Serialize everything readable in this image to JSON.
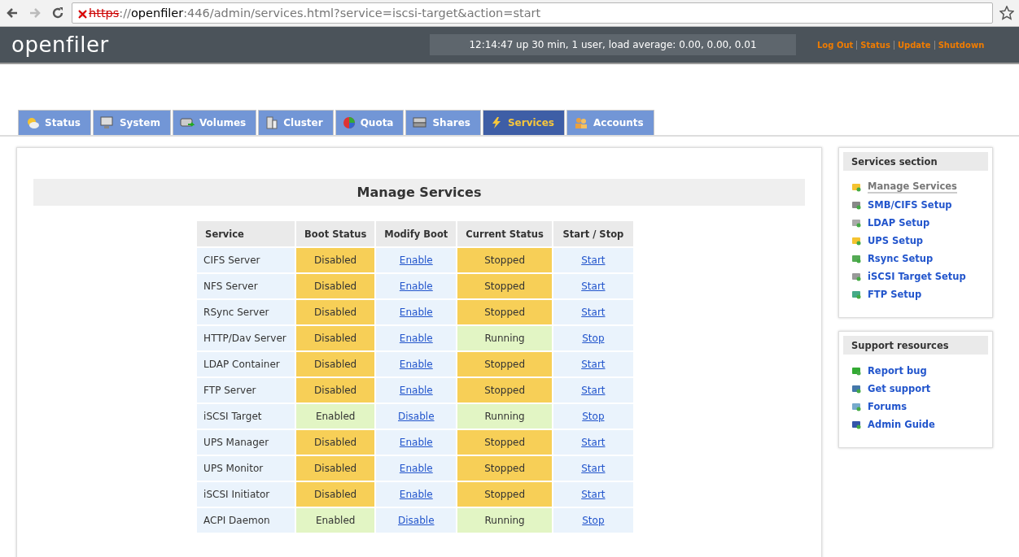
{
  "browser": {
    "secure": false,
    "url": {
      "scheme": "https",
      "separator": "://",
      "host": "openfiler",
      "path": ":446/admin/services.html?service=iscsi-target&action=start"
    }
  },
  "header": {
    "logo": "openfiler",
    "uptime": "12:14:47 up 30 min, 1 user, load average: 0.00, 0.00, 0.01",
    "links": [
      "Log Out",
      "Status",
      "Update",
      "Shutdown"
    ]
  },
  "tabs": [
    {
      "label": "Status",
      "selected": false
    },
    {
      "label": "System",
      "selected": false
    },
    {
      "label": "Volumes",
      "selected": false
    },
    {
      "label": "Cluster",
      "selected": false
    },
    {
      "label": "Quota",
      "selected": false
    },
    {
      "label": "Shares",
      "selected": false
    },
    {
      "label": "Services",
      "selected": true
    },
    {
      "label": "Accounts",
      "selected": false
    }
  ],
  "main": {
    "title": "Manage Services",
    "columns": [
      "Service",
      "Boot Status",
      "Modify Boot",
      "Current Status",
      "Start / Stop"
    ],
    "rows": [
      {
        "service": "CIFS Server",
        "boot_status": "Disabled",
        "boot_enabled": false,
        "modify_boot": "Enable",
        "current_status": "Stopped",
        "running": false,
        "action": "Start"
      },
      {
        "service": "NFS Server",
        "boot_status": "Disabled",
        "boot_enabled": false,
        "modify_boot": "Enable",
        "current_status": "Stopped",
        "running": false,
        "action": "Start"
      },
      {
        "service": "RSync Server",
        "boot_status": "Disabled",
        "boot_enabled": false,
        "modify_boot": "Enable",
        "current_status": "Stopped",
        "running": false,
        "action": "Start"
      },
      {
        "service": "HTTP/Dav Server",
        "boot_status": "Disabled",
        "boot_enabled": false,
        "modify_boot": "Enable",
        "current_status": "Running",
        "running": true,
        "action": "Stop"
      },
      {
        "service": "LDAP Container",
        "boot_status": "Disabled",
        "boot_enabled": false,
        "modify_boot": "Enable",
        "current_status": "Stopped",
        "running": false,
        "action": "Start"
      },
      {
        "service": "FTP Server",
        "boot_status": "Disabled",
        "boot_enabled": false,
        "modify_boot": "Enable",
        "current_status": "Stopped",
        "running": false,
        "action": "Start"
      },
      {
        "service": "iSCSI Target",
        "boot_status": "Enabled",
        "boot_enabled": true,
        "modify_boot": "Disable",
        "current_status": "Running",
        "running": true,
        "action": "Stop"
      },
      {
        "service": "UPS Manager",
        "boot_status": "Disabled",
        "boot_enabled": false,
        "modify_boot": "Enable",
        "current_status": "Stopped",
        "running": false,
        "action": "Start"
      },
      {
        "service": "UPS Monitor",
        "boot_status": "Disabled",
        "boot_enabled": false,
        "modify_boot": "Enable",
        "current_status": "Stopped",
        "running": false,
        "action": "Start"
      },
      {
        "service": "iSCSI Initiator",
        "boot_status": "Disabled",
        "boot_enabled": false,
        "modify_boot": "Enable",
        "current_status": "Stopped",
        "running": false,
        "action": "Start"
      },
      {
        "service": "ACPI Daemon",
        "boot_status": "Enabled",
        "boot_enabled": true,
        "modify_boot": "Disable",
        "current_status": "Running",
        "running": true,
        "action": "Stop"
      }
    ]
  },
  "sidebar": [
    {
      "title": "Services section",
      "items": [
        {
          "label": "Manage Services",
          "selected": true
        },
        {
          "label": "SMB/CIFS Setup",
          "selected": false
        },
        {
          "label": "LDAP Setup",
          "selected": false
        },
        {
          "label": "UPS Setup",
          "selected": false
        },
        {
          "label": "Rsync Setup",
          "selected": false
        },
        {
          "label": "iSCSI Target Setup",
          "selected": false
        },
        {
          "label": "FTP Setup",
          "selected": false
        }
      ]
    },
    {
      "title": "Support resources",
      "items": [
        {
          "label": "Report bug",
          "selected": false
        },
        {
          "label": "Get support",
          "selected": false
        },
        {
          "label": "Forums",
          "selected": false
        },
        {
          "label": "Admin Guide",
          "selected": false
        }
      ]
    }
  ]
}
